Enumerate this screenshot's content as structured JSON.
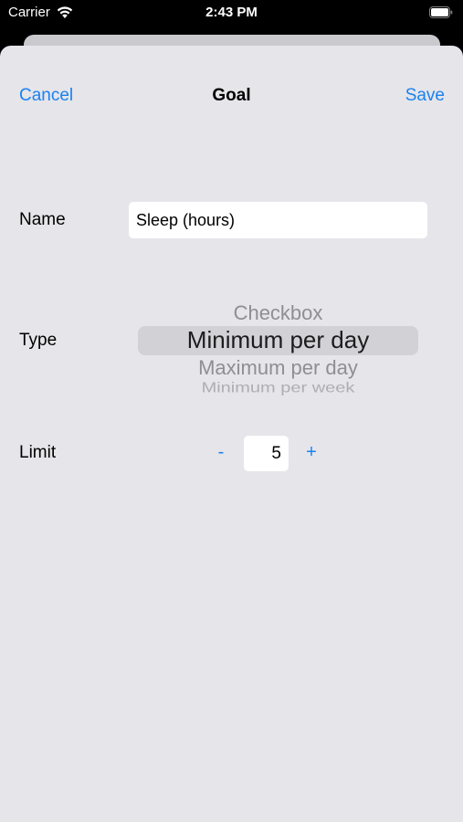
{
  "status_bar": {
    "carrier": "Carrier",
    "time": "2:43 PM",
    "wifi_icon": "wifi-icon",
    "battery_icon": "battery-icon"
  },
  "nav": {
    "cancel_label": "Cancel",
    "title": "Goal",
    "save_label": "Save"
  },
  "form": {
    "name": {
      "label": "Name",
      "value": "Sleep (hours)"
    },
    "type": {
      "label": "Type",
      "options": [
        "Checkbox",
        "Minimum per day",
        "Maximum per day",
        "Minimum per week"
      ],
      "selected": "Minimum per day"
    },
    "limit": {
      "label": "Limit",
      "decrement_label": "-",
      "value": "5",
      "increment_label": "+"
    }
  },
  "colors": {
    "accent": "#1a82f0",
    "sheet_background": "#e5e5ea",
    "field_background": "#ffffff",
    "picker_selection": "#d1d1d6"
  }
}
